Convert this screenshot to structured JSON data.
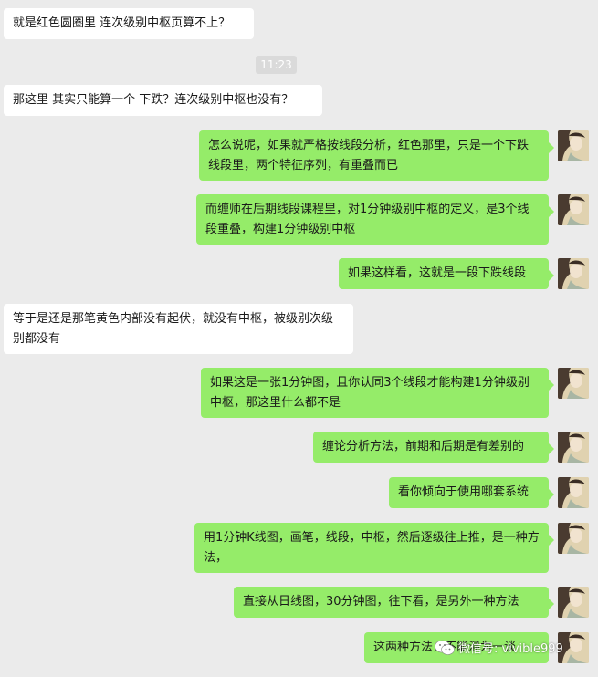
{
  "timestamp": "11:23",
  "messages": [
    {
      "side": "in",
      "text": "就是红色圆圈里 连次级别中枢页算不上？"
    },
    {
      "side": "in",
      "text": "那这里 其实只能算一个 下跌？连次级别中枢也没有？"
    },
    {
      "side": "out",
      "text": "怎么说呢，如果就严格按线段分析，红色那里，只是一个下跌线段里，两个特征序列，有重叠而已"
    },
    {
      "side": "out",
      "text": "而缠师在后期线段课程里，对1分钟级别中枢的定义，是3个线段重叠，构建1分钟级别中枢"
    },
    {
      "side": "out",
      "text": "如果这样看，这就是一段下跌线段"
    },
    {
      "side": "in",
      "text": "等于是还是那笔黄色内部没有起伏，就没有中枢，被级别次级别都没有"
    },
    {
      "side": "out",
      "text": "如果这是一张1分钟图，且你认同3个线段才能构建1分钟级别中枢，那这里什么都不是"
    },
    {
      "side": "out",
      "text": "缠论分析方法，前期和后期是有差别的"
    },
    {
      "side": "out",
      "text": "看你倾向于使用哪套系统"
    },
    {
      "side": "out",
      "text": "用1分钟K线图，画笔，线段，中枢，然后逐级往上推，是一种方法，"
    },
    {
      "side": "out",
      "text": "直接从日线图，30分钟图，往下看，是另外一种方法"
    },
    {
      "side": "out",
      "text": "这两种方法，不能混为一谈"
    }
  ],
  "watermark": {
    "text": "微信号: vivible999",
    "icon": "wechat-icon"
  },
  "avatar_icon": "user-avatar-painting-icon",
  "colors": {
    "background": "#ebebeb",
    "incoming": "#ffffff",
    "outgoing": "#95ec69",
    "timestamp_bg": "#dadada"
  }
}
